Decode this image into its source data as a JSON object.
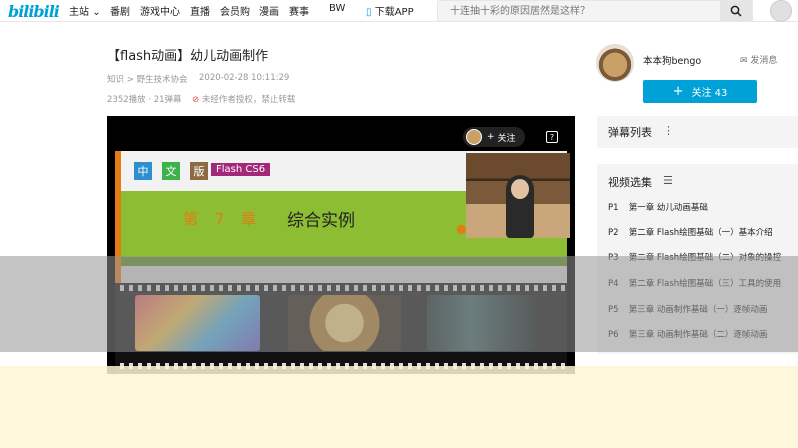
{
  "header": {
    "logo": "bilibili",
    "nav": [
      "主站",
      "番剧",
      "游戏中心",
      "直播",
      "会员购",
      "漫画",
      "赛事",
      "BW",
      "下载APP"
    ],
    "search_placeholder": "十连抽十彩的原因居然是这样？"
  },
  "video": {
    "title": "【flash动画】幼儿动画制作",
    "breadcrumb": "知识 > 野生技术协会",
    "date": "2020-02-28 10:11:29",
    "plays": "2352播放 · 21弹幕",
    "copyright": "未经作者授权，禁止转载"
  },
  "uploader": {
    "name": "本本狗bengo",
    "message_label": "发消息",
    "follow_label": "关注 43"
  },
  "player": {
    "follow_label": "关注",
    "help_icon": "?",
    "slide": {
      "tags": [
        "中",
        "文",
        "版"
      ],
      "software_tag": "Flash CS6",
      "chapter": "第 7 章",
      "chapter_title": "综合实例"
    }
  },
  "danmaku": {
    "title": "弹幕列表"
  },
  "episodes": {
    "title": "视频选集",
    "items": [
      {
        "num": "P1",
        "label": "第一章 幼儿动画基础"
      },
      {
        "num": "P2",
        "label": "第二章 Flash绘图基础（一）基本介绍"
      },
      {
        "num": "P3",
        "label": "第二章 Flash绘图基础（二）对象的操控"
      },
      {
        "num": "P4",
        "label": "第二章 Flash绘图基础（三）工具的使用"
      },
      {
        "num": "P5",
        "label": "第三章 动画制作基础（一）逐帧动画"
      },
      {
        "num": "P6",
        "label": "第三章 动画制作基础（二）逐帧动画"
      }
    ]
  },
  "colors": {
    "brand": "#00a1d6",
    "slide_green": "#8cbd33",
    "chapter_orange": "#e57b14",
    "flash_tag": "#a3287a"
  }
}
